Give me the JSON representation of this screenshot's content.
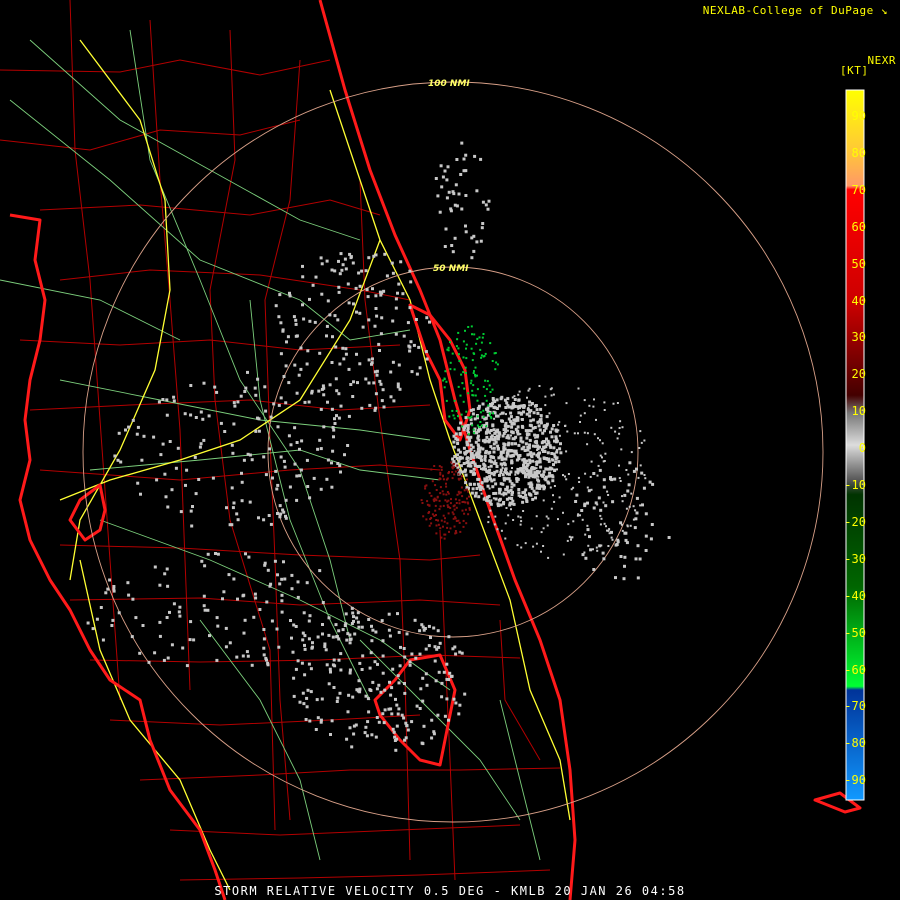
{
  "header": {
    "brand": "NEXLAB-College of DuPage",
    "brand_icon": "nexlab-logo-icon",
    "product": "NEXR",
    "unit": "[KT]"
  },
  "range_rings": [
    {
      "label": "100 NMI"
    },
    {
      "label": "50 NMI"
    }
  ],
  "legend": {
    "ticks": [
      "90",
      "80",
      "70",
      "60",
      "50",
      "40",
      "30",
      "20",
      "10",
      "0",
      "-10",
      "-20",
      "-30",
      "-40",
      "-50",
      "-60",
      "-70",
      "-80",
      "-90"
    ],
    "colors": {
      "high": "#ffff00",
      "mid_high": "#ff8844",
      "red": "#ff0000",
      "dark_red": "#660000",
      "gray": "#aaaaaa",
      "dark_green": "#005500",
      "green": "#00ee33",
      "blue": "#0044aa",
      "light_blue": "#0099ff"
    }
  },
  "footer": {
    "caption": "STORM RELATIVE VELOCITY 0.5 DEG - KMLB 20 JAN 26 04:58"
  },
  "map_colors": {
    "coast": "#ff1a1a",
    "county": "#cc0000",
    "highway": "#ffff33",
    "road": "#88dd88",
    "ring": "#d9a088",
    "echo_gray": "#c8c8c8",
    "echo_green": "#00cc33",
    "echo_darkred": "#8b1010"
  }
}
